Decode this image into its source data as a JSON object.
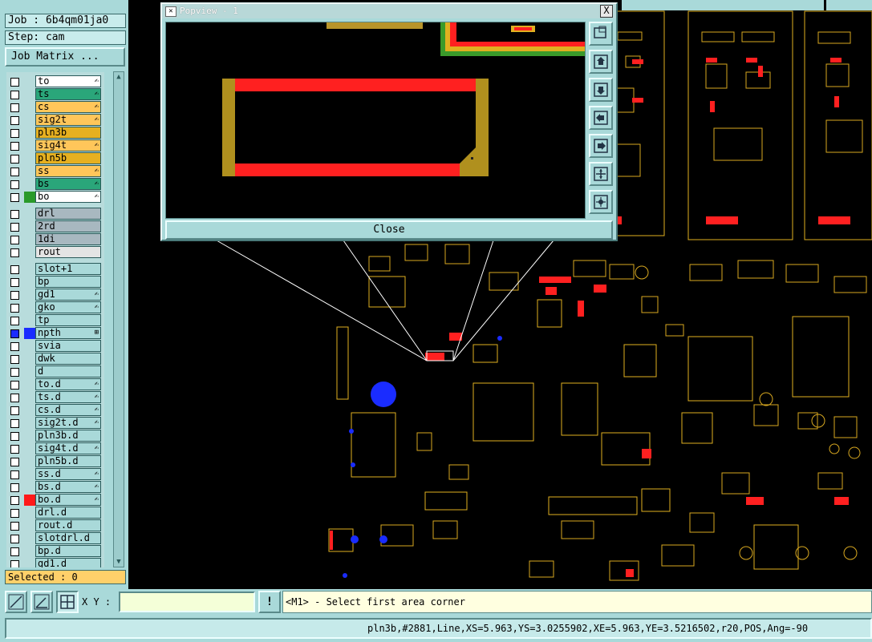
{
  "job": {
    "name_line": "Job : 6b4qm01ja0",
    "step_line": "Step: cam",
    "matrix_button": "Job Matrix ..."
  },
  "colors": {
    "panel": "#a9d9d9",
    "canvas_bg": "#000000",
    "trace": "#e0b020",
    "pad": "#ff2020",
    "via": "#1a2cff"
  },
  "layers": [
    {
      "name": "to",
      "color": "#ffffff",
      "swatch": "",
      "mark": "✍"
    },
    {
      "name": "ts",
      "color": "#2aa67a",
      "swatch": "",
      "mark": "✍"
    },
    {
      "name": "cs",
      "color": "#ffc65a",
      "swatch": "",
      "mark": "✍"
    },
    {
      "name": "sig2t",
      "color": "#ffc65a",
      "swatch": "",
      "mark": "✍"
    },
    {
      "name": "pln3b",
      "color": "#e6b020",
      "swatch": "",
      "mark": ""
    },
    {
      "name": "sig4t",
      "color": "#ffc65a",
      "swatch": "",
      "mark": "✍"
    },
    {
      "name": "pln5b",
      "color": "#e6b020",
      "swatch": "",
      "mark": ""
    },
    {
      "name": "ss",
      "color": "#ffc65a",
      "swatch": "",
      "mark": "✍"
    },
    {
      "name": "bs",
      "color": "#2aa67a",
      "swatch": "",
      "mark": "✍"
    },
    {
      "name": "bo",
      "color": "#ffffff",
      "swatch": "#2a9a2a",
      "mark": "✍"
    },
    {
      "name": "drl",
      "color": "#a8b8c0",
      "swatch": "",
      "mark": ""
    },
    {
      "name": "2rd",
      "color": "#a8b8c0",
      "swatch": "",
      "mark": ""
    },
    {
      "name": "1di",
      "color": "#a8b8c0",
      "swatch": "",
      "mark": ""
    },
    {
      "name": "rout",
      "color": "#e4e4e4",
      "swatch": "",
      "mark": ""
    },
    {
      "name": "slot+1",
      "color": "#a9d9d9",
      "swatch": "",
      "mark": ""
    },
    {
      "name": "bp",
      "color": "#a9d9d9",
      "swatch": "",
      "mark": ""
    },
    {
      "name": "gd1",
      "color": "#a9d9d9",
      "swatch": "",
      "mark": "✍"
    },
    {
      "name": "gko",
      "color": "#a9d9d9",
      "swatch": "",
      "mark": "✍"
    },
    {
      "name": "tp",
      "color": "#a9d9d9",
      "swatch": "",
      "mark": ""
    },
    {
      "name": "npth",
      "color": "#a9d9d9",
      "swatch": "#1a2cff",
      "mark": "⊞"
    },
    {
      "name": "svia",
      "color": "#a9d9d9",
      "swatch": "",
      "mark": ""
    },
    {
      "name": "dwk",
      "color": "#a9d9d9",
      "swatch": "",
      "mark": ""
    },
    {
      "name": "d",
      "color": "#a9d9d9",
      "swatch": "",
      "mark": ""
    },
    {
      "name": "to.d",
      "color": "#a9d9d9",
      "swatch": "",
      "mark": "✍"
    },
    {
      "name": "ts.d",
      "color": "#a9d9d9",
      "swatch": "",
      "mark": "✍"
    },
    {
      "name": "cs.d",
      "color": "#a9d9d9",
      "swatch": "",
      "mark": "✍"
    },
    {
      "name": "sig2t.d",
      "color": "#a9d9d9",
      "swatch": "",
      "mark": "✍"
    },
    {
      "name": "pln3b.d",
      "color": "#a9d9d9",
      "swatch": "",
      "mark": ""
    },
    {
      "name": "sig4t.d",
      "color": "#a9d9d9",
      "swatch": "",
      "mark": "✍"
    },
    {
      "name": "pln5b.d",
      "color": "#a9d9d9",
      "swatch": "",
      "mark": ""
    },
    {
      "name": "ss.d",
      "color": "#a9d9d9",
      "swatch": "",
      "mark": "✍"
    },
    {
      "name": "bs.d",
      "color": "#a9d9d9",
      "swatch": "",
      "mark": "✍"
    },
    {
      "name": "bo.d",
      "color": "#a9d9d9",
      "swatch": "#ff1a1a",
      "mark": "✍"
    },
    {
      "name": "drl.d",
      "color": "#a9d9d9",
      "swatch": "",
      "mark": ""
    },
    {
      "name": "rout.d",
      "color": "#a9d9d9",
      "swatch": "",
      "mark": ""
    },
    {
      "name": "slotdrl.d",
      "color": "#a9d9d9",
      "swatch": "",
      "mark": ""
    },
    {
      "name": "bp.d",
      "color": "#a9d9d9",
      "swatch": "",
      "mark": ""
    },
    {
      "name": "gd1.d",
      "color": "#a9d9d9",
      "swatch": "",
      "mark": ""
    }
  ],
  "selected": "Selected : 0",
  "popview": {
    "title": "Popview - 1",
    "close_label": "Close",
    "close_x": "X",
    "buttons": [
      "zoom-home",
      "zoom-top",
      "zoom-bottom",
      "pan-left",
      "pan-right",
      "zoom-in",
      "zoom-out"
    ]
  },
  "cmd": {
    "xy_label": "X Y :",
    "xy_value": "",
    "info_label": "!",
    "prompt": "<M1> - Select first area corner"
  },
  "status": "pln3b,#2881,Line,XS=5.963,YS=3.0255902,XE=5.963,YE=3.5216502,r20,POS,Ang=-90"
}
